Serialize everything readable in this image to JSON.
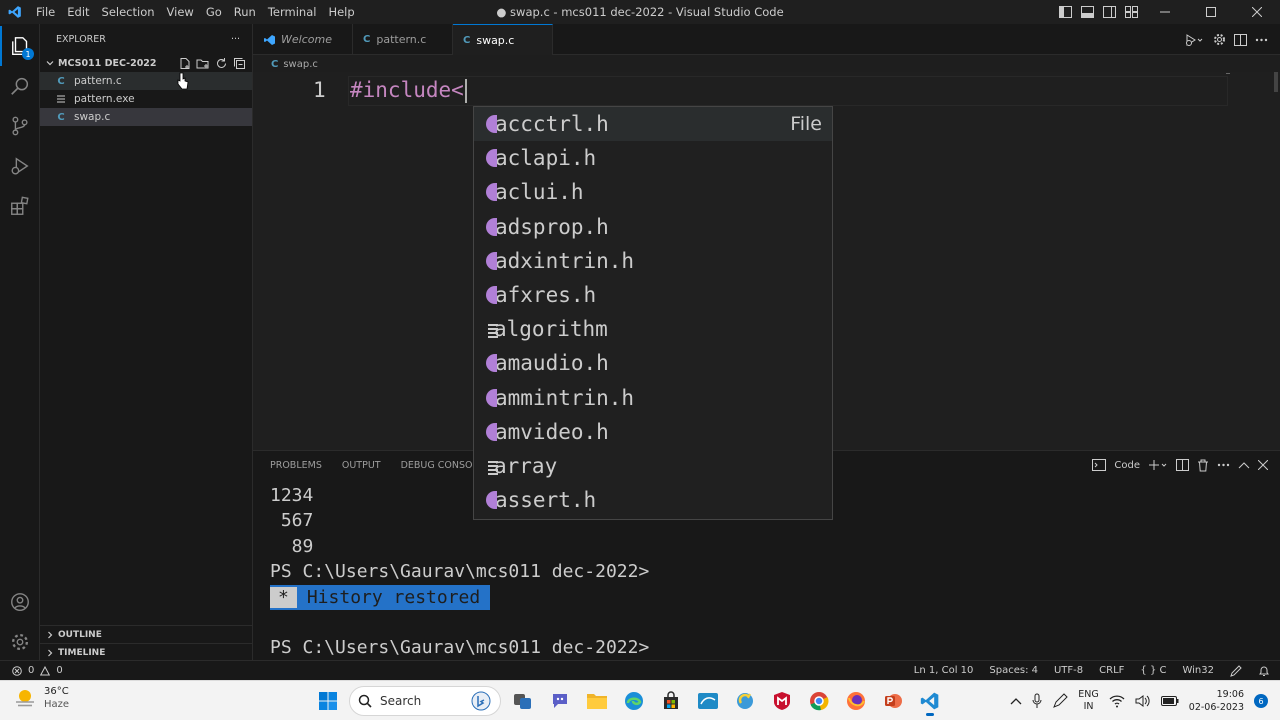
{
  "titlebar": {
    "menu": [
      "File",
      "Edit",
      "Selection",
      "View",
      "Go",
      "Run",
      "Terminal",
      "Help"
    ],
    "title": "● swap.c - mcs011 dec-2022 - Visual Studio Code"
  },
  "activitybar": {
    "explorer_badge": "1"
  },
  "sidebar": {
    "title": "EXPLORER",
    "more": "···",
    "folder": "MCS011 DEC-2022",
    "files": [
      {
        "icon": "C",
        "name": "pattern.c"
      },
      {
        "icon": "",
        "name": "pattern.exe"
      },
      {
        "icon": "C",
        "name": "swap.c"
      }
    ],
    "outline": "OUTLINE",
    "timeline": "TIMELINE"
  },
  "tabs": [
    {
      "label": "Welcome"
    },
    {
      "icon": "C",
      "label": "pattern.c"
    },
    {
      "icon": "C",
      "label": "swap.c"
    }
  ],
  "breadcrumb": {
    "icon": "C",
    "file": "swap.c"
  },
  "editor": {
    "line_number": "1",
    "code": "#include<"
  },
  "suggest": {
    "items": [
      {
        "kind": "file",
        "label": "accctrl.h",
        "detail": "File"
      },
      {
        "kind": "file",
        "label": "aclapi.h"
      },
      {
        "kind": "file",
        "label": "aclui.h"
      },
      {
        "kind": "file",
        "label": "adsprop.h"
      },
      {
        "kind": "file",
        "label": "adxintrin.h"
      },
      {
        "kind": "file",
        "label": "afxres.h"
      },
      {
        "kind": "text",
        "label": "algorithm"
      },
      {
        "kind": "file",
        "label": "amaudio.h"
      },
      {
        "kind": "file",
        "label": "ammintrin.h"
      },
      {
        "kind": "file",
        "label": "amvideo.h"
      },
      {
        "kind": "text",
        "label": "array"
      },
      {
        "kind": "file",
        "label": "assert.h"
      }
    ]
  },
  "panel": {
    "tabs": [
      "PROBLEMS",
      "OUTPUT",
      "DEBUG CONSOLE"
    ],
    "terminal_name": "Code",
    "terminal": {
      "line1": "1234",
      "line2": " 567",
      "line3": "  89",
      "prompt1": "PS C:\\Users\\Gaurav\\mcs011 dec-2022>",
      "history_star": "*",
      "history_text": "History restored",
      "prompt2": "PS C:\\Users\\Gaurav\\mcs011 dec-2022>"
    }
  },
  "statusbar": {
    "errors": "0",
    "warnings": "0",
    "position": "Ln 1, Col 10",
    "spaces": "Spaces: 4",
    "encoding": "UTF-8",
    "eol": "CRLF",
    "language": "C",
    "platform": "Win32"
  },
  "taskbar": {
    "temperature": "36°C",
    "condition": "Haze",
    "search_placeholder": "Search",
    "lang1": "ENG",
    "lang2": "IN",
    "time": "19:06",
    "date": "02-06-2023",
    "notifications": "6"
  },
  "colors": {
    "accent": "#0078d4",
    "c_file_icon": "#519aba",
    "keyword": "#c586c0",
    "history_bg": "#2472c8"
  }
}
